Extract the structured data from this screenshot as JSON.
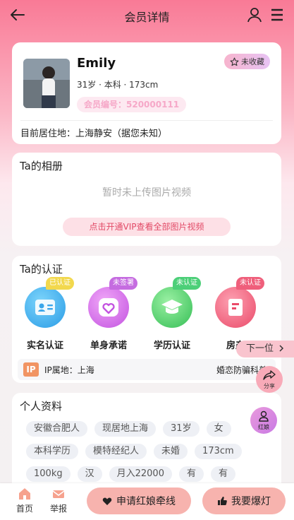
{
  "header": {
    "title": "会员详情"
  },
  "profile": {
    "name": "Emily",
    "collect_label": "未收藏",
    "meta": "31岁 · 本科 · 173cm",
    "member_no": "会员编号：520000111",
    "residence": "目前居住地：上海静安（据您未知）"
  },
  "album": {
    "title": "Ta的相册",
    "empty_text": "暂时未上传图片视频",
    "vip_label": "点击开通VIP查看全部图片视频"
  },
  "cert": {
    "title": "Ta的认证",
    "items": [
      {
        "label": "实名认证",
        "badge": "已认证",
        "badge_color": "#f2d84d",
        "icon_color": "#43b6f3",
        "icon": "id-card-icon"
      },
      {
        "label": "单身承诺",
        "badge": "未签署",
        "badge_color": "#c56ce0",
        "icon_color": "#d266e8",
        "icon": "heart-icon"
      },
      {
        "label": "学历认证",
        "badge": "未认证",
        "badge_color": "#4ccf78",
        "icon_color": "#52d06b",
        "icon": "graduation-cap-icon"
      },
      {
        "label": "房产",
        "badge": "未认证",
        "badge_color": "#ef5f7b",
        "icon_color": "#f2627f",
        "icon": "house-icon"
      }
    ],
    "ip_logo": "IP",
    "ip_text": "IP属地：上海",
    "ip_right": "婚恋防骗科普"
  },
  "next_label": "下一位",
  "share_label": "分享",
  "hongniang_label": "红娘",
  "info": {
    "title": "个人资料",
    "tags": [
      "安徽合肥人",
      "现居地上海",
      "31岁",
      "女",
      "本科学历",
      "模特经纪人",
      "未婚",
      "173cm",
      "100kg",
      "汉",
      "月入22000",
      "有",
      "有"
    ]
  },
  "bottom": {
    "home": "首页",
    "report": "举报",
    "apply": "申请红娘牵线",
    "boost": "我要爆灯"
  }
}
